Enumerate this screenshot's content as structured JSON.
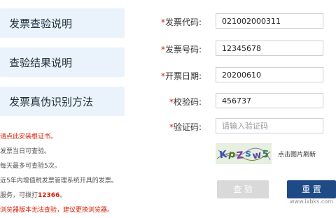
{
  "nav": {
    "items": [
      {
        "label": "发票查验说明"
      },
      {
        "label": "查验结果说明"
      },
      {
        "label": "发票真伪识别方法"
      }
    ]
  },
  "notes": {
    "lines": [
      "请点此安装根证书。",
      "发票当日可查验。",
      "每天最多可查验5次。",
      "近5年内增值税发票管理系统开具的发票。",
      "服务，可拨打",
      "浏览器版本无法查验，建议更换浏览器。"
    ],
    "hotline": "12366"
  },
  "form": {
    "code": {
      "label": "发票代码:",
      "value": "021002000311"
    },
    "number": {
      "label": "发票号码:",
      "value": "12345678"
    },
    "date": {
      "label": "开票日期:",
      "value": "20200610"
    },
    "check": {
      "label": "校验码:",
      "value": "456737"
    },
    "captcha": {
      "label": "验证码:",
      "placeholder": "请输入验证码"
    }
  },
  "captcha_refresh": "点击图片刷新",
  "buttons": {
    "query": "查 验",
    "reset": "重 置"
  },
  "watermark": "www.ixbks.com",
  "colors": {
    "accent": "#1e4a86",
    "required": "#d81e06",
    "nav_bg": "#eaf3fb"
  }
}
